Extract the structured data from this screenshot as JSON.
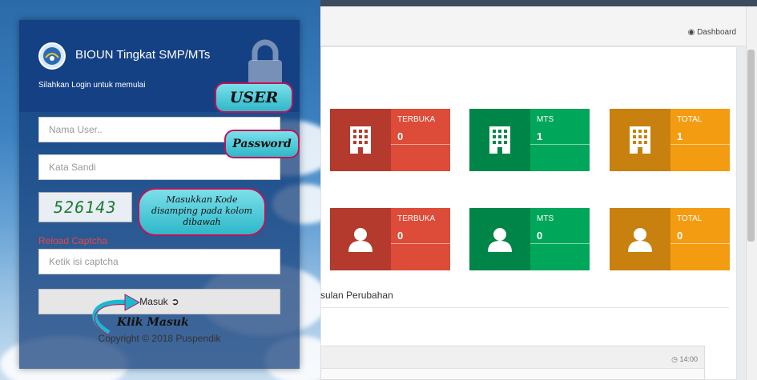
{
  "login": {
    "app_title": "BIOUN Tingkat SMP/MTs",
    "subtitle": "Silahkan Login untuk memulai",
    "username_placeholder": "Nama User..",
    "password_placeholder": "Kata Sandi",
    "captcha_text": "526143",
    "reload_label": "Reload Captcha",
    "captcha_placeholder": "Ketik isi captcha",
    "submit_label": "Masuk",
    "copyright": "Copyright © 2018 Puspendik"
  },
  "annotations": {
    "user": "USER",
    "password": "Password",
    "kode_line1": "Masukkan Kode",
    "kode_line2": "disamping pada kolom",
    "kode_line3": "dibawah",
    "klik": "Klik Masuk"
  },
  "dashboard": {
    "breadcrumb": "Dashboard",
    "row1": [
      {
        "label": "TERBUKA",
        "value": "0",
        "color": "#dd4b39"
      },
      {
        "label": "MTS",
        "value": "1",
        "color": "#00a65a"
      },
      {
        "label": "TOTAL",
        "value": "1",
        "color": "#f39c12"
      }
    ],
    "row2": [
      {
        "label": "TERBUKA",
        "value": "0",
        "color": "#dd4b39"
      },
      {
        "label": "MTS",
        "value": "0",
        "color": "#00a65a"
      },
      {
        "label": "TOTAL",
        "value": "0",
        "color": "#f39c12"
      }
    ],
    "usulan_text": "sulan Perubahan",
    "time": "14:00"
  }
}
